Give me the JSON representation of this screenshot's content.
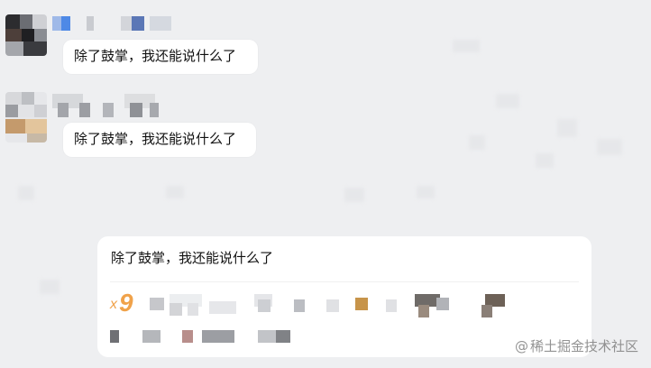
{
  "chat": {
    "messages": [
      {
        "text": "除了鼓掌，我还能说什么了"
      },
      {
        "text": "除了鼓掌，我还能说什么了"
      }
    ],
    "quote_card": {
      "text": "除了鼓掌，我还能说什么了",
      "count_prefix": "x",
      "count": "9"
    }
  },
  "watermark": {
    "at": "@",
    "text": "稀土掘金技术社区"
  },
  "colors": {
    "background": "#eeeff1",
    "bubble": "#ffffff",
    "count_accent": "#f0a24a"
  }
}
